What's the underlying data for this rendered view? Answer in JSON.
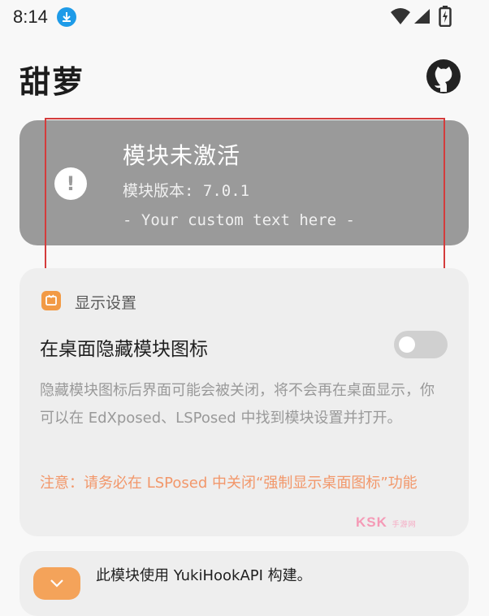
{
  "status_bar": {
    "time": "8:14",
    "download_icon": "download-icon",
    "wifi_icon": "wifi-icon",
    "signal_icon": "signal-icon",
    "battery_icon": "battery-icon"
  },
  "header": {
    "title": "甜萝",
    "action_icon": "github-icon"
  },
  "status_card": {
    "icon": "warning-icon",
    "title": "模块未激活",
    "version": "模块版本: 7.0.1",
    "custom_text": "- Your custom text here -",
    "background": "#9a9a9a"
  },
  "display_settings": {
    "section_icon": "display-settings-icon",
    "section_title": "显示设置",
    "hide_icon_label": "在桌面隐藏模块图标",
    "hide_icon_enabled": false,
    "description": "隐藏模块图标后界面可能会被关闭，将不会再在桌面显示，你可以在 EdXposed、LSPosed 中找到模块设置并打开。",
    "note": "注意：请务必在 LSPosed 中关闭“强制显示桌面图标”功能",
    "accent": "#f29a45",
    "note_color": "#f2976a"
  },
  "info_card": {
    "icon": "expand-icon",
    "text": "此模块使用 YukiHookAPI 构建。"
  },
  "watermark": {
    "brand": "KSK",
    "sub": "手游网"
  }
}
